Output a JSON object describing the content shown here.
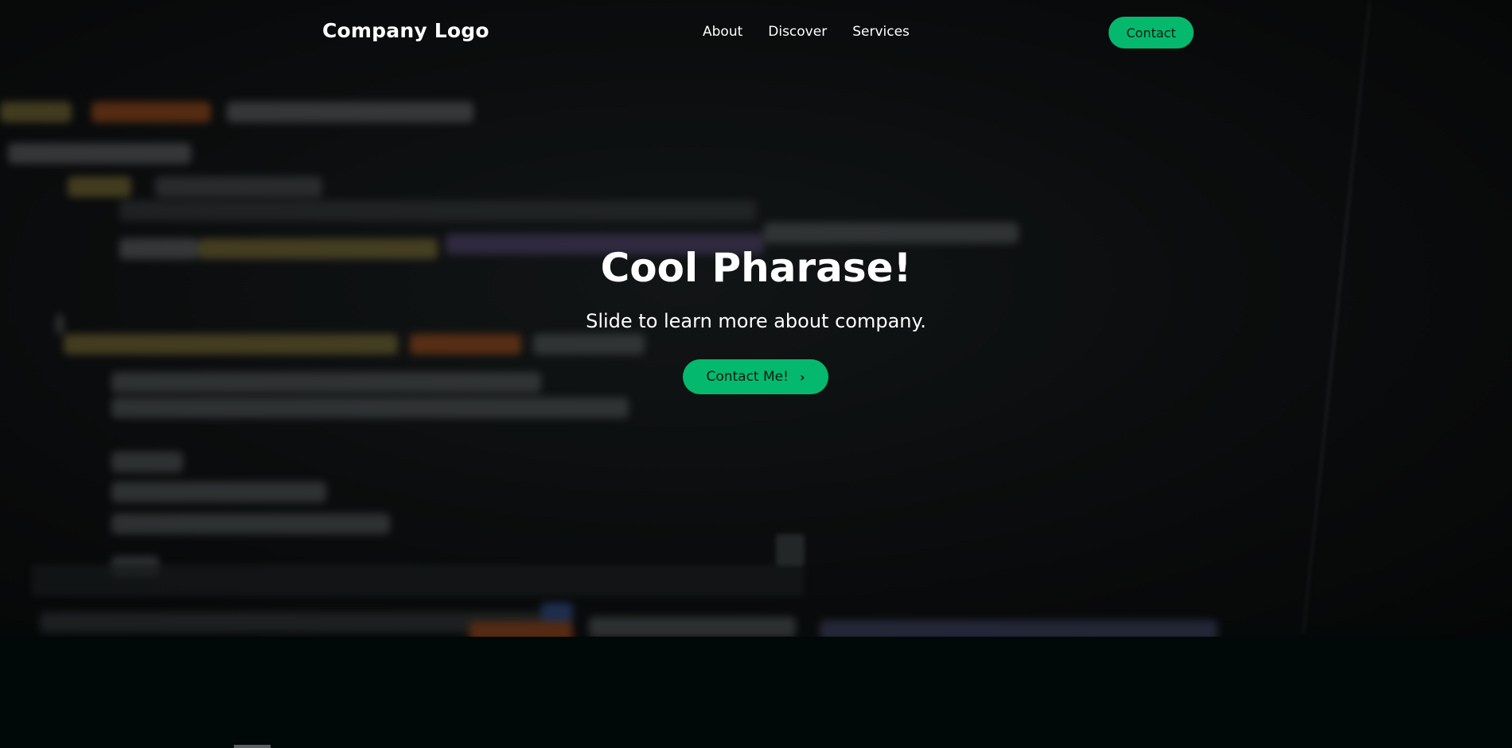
{
  "navbar": {
    "logo": "Company Logo",
    "links": [
      "About",
      "Discover",
      "Services"
    ],
    "contact_label": "Contact"
  },
  "hero": {
    "title": "Cool Pharase!",
    "subtitle": "Slide to learn more about company.",
    "cta_label": "Contact Me!",
    "cta_icon": "chevron-right-icon"
  },
  "colors": {
    "accent": "#04b96d",
    "background": "#010808",
    "text": "#ffffff"
  }
}
